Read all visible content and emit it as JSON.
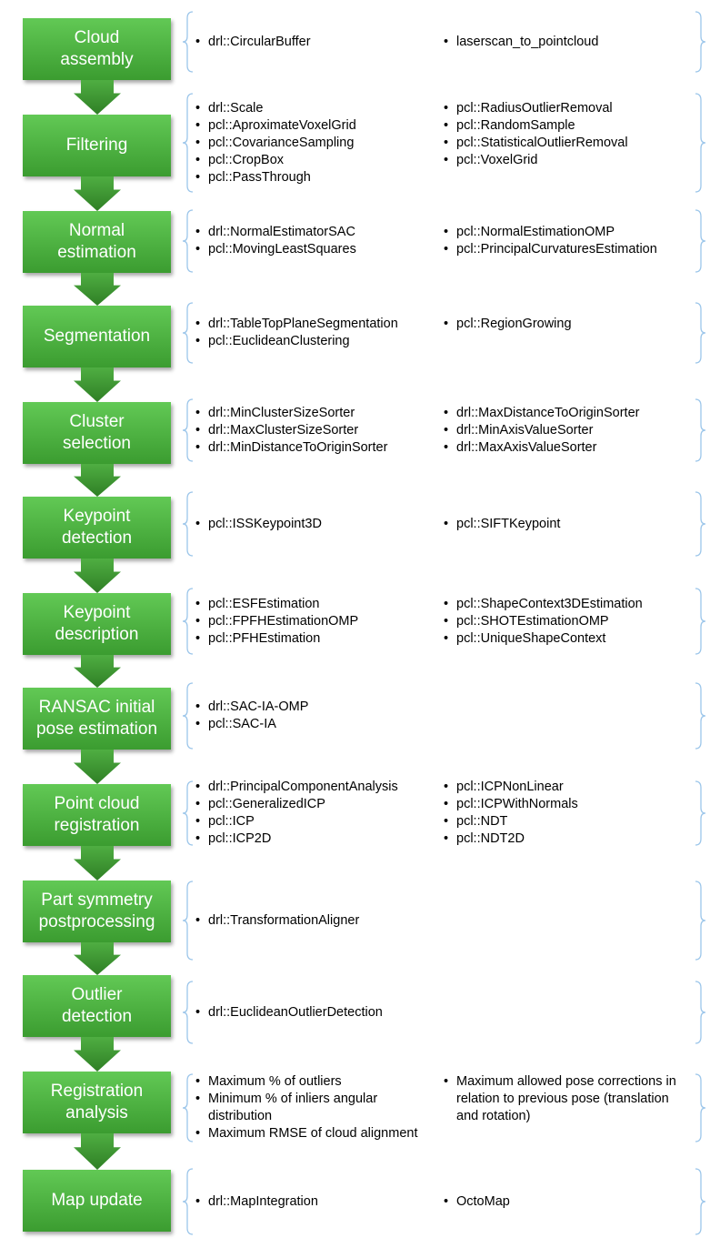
{
  "colors": {
    "box_top": "#62c955",
    "box_bottom": "#3b9c30",
    "arrow": "#3f9a32",
    "brace": "#9cc6ea"
  },
  "stages": [
    {
      "label": "Cloud\nassembly",
      "col1": [
        "drl::CircularBuffer"
      ],
      "col2": [
        "laserscan_to_pointcloud"
      ]
    },
    {
      "label": "Filtering",
      "col1": [
        "drl::Scale",
        "pcl::AproximateVoxelGrid",
        "pcl::CovarianceSampling",
        "pcl::CropBox",
        "pcl::PassThrough"
      ],
      "col2": [
        "pcl::RadiusOutlierRemoval",
        "pcl::RandomSample",
        "pcl::StatisticalOutlierRemoval",
        "pcl::VoxelGrid"
      ]
    },
    {
      "label": "Normal\nestimation",
      "col1": [
        "drl::NormalEstimatorSAC",
        "pcl::MovingLeastSquares"
      ],
      "col2": [
        "pcl::NormalEstimationOMP",
        "pcl::PrincipalCurvaturesEstimation"
      ]
    },
    {
      "label": "Segmentation",
      "col1": [
        "drl::TableTopPlaneSegmentation",
        "pcl::EuclideanClustering"
      ],
      "col2": [
        "pcl::RegionGrowing"
      ]
    },
    {
      "label": "Cluster\nselection",
      "col1": [
        "drl::MinClusterSizeSorter",
        "drl::MaxClusterSizeSorter",
        "drl::MinDistanceToOriginSorter"
      ],
      "col2": [
        "drl::MaxDistanceToOriginSorter",
        "drl::MinAxisValueSorter",
        "drl::MaxAxisValueSorter"
      ]
    },
    {
      "label": "Keypoint\ndetection",
      "col1": [
        "pcl::ISSKeypoint3D"
      ],
      "col2": [
        "pcl::SIFTKeypoint"
      ]
    },
    {
      "label": "Keypoint\ndescription",
      "col1": [
        "pcl::ESFEstimation",
        "pcl::FPFHEstimationOMP",
        "pcl::PFHEstimation"
      ],
      "col2": [
        "pcl::ShapeContext3DEstimation",
        "pcl::SHOTEstimationOMP",
        "pcl::UniqueShapeContext"
      ]
    },
    {
      "label": "RANSAC initial\npose estimation",
      "col1": [
        "drl::SAC-IA-OMP",
        "pcl::SAC-IA"
      ],
      "col2": []
    },
    {
      "label": "Point cloud\nregistration",
      "col1": [
        "drl::PrincipalComponentAnalysis",
        "pcl::GeneralizedICP",
        "pcl::ICP",
        "pcl::ICP2D"
      ],
      "col2": [
        "pcl::ICPNonLinear",
        "pcl::ICPWithNormals",
        "pcl::NDT",
        "pcl::NDT2D"
      ]
    },
    {
      "label": "Part symmetry\npostprocessing",
      "col1": [
        "drl::TransformationAligner"
      ],
      "col2": []
    },
    {
      "label": "Outlier\ndetection",
      "col1": [
        "drl::EuclideanOutlierDetection"
      ],
      "col2": []
    },
    {
      "label": "Registration\nanalysis",
      "col1": [
        "Maximum % of outliers",
        "Minimum % of inliers angular distribution",
        "Maximum RMSE of cloud alignment"
      ],
      "col2": [
        "Maximum allowed pose corrections in relation to previous pose (translation and rotation)"
      ]
    },
    {
      "label": "Map update",
      "col1": [
        "drl::MapIntegration"
      ],
      "col2": [
        "OctoMap"
      ]
    }
  ]
}
